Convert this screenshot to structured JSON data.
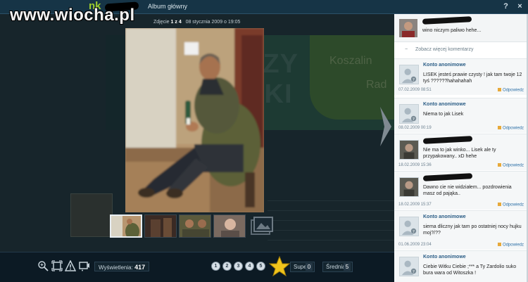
{
  "watermark": "www.wiocha.pl",
  "topbar": {
    "logo_nk": "nk",
    "album_title": "Album główny",
    "help": "?",
    "close": "×"
  },
  "photo": {
    "counter_prefix": "Zdjęcie",
    "counter": "1 z 4",
    "date": "08 stycznia 2009 o 19:05"
  },
  "toolbar": {
    "views_label": "Wyświetlenia:",
    "views_value": "417",
    "rating_buttons": [
      "1",
      "2",
      "3",
      "4",
      "5"
    ],
    "super_label": "Super",
    "super_value": "0",
    "avg_label": "Średnia:",
    "avg_value": "5"
  },
  "comments": {
    "top_text": "wino niczym paliwo hehe...",
    "more_link": "Zobacz więcej komentarzy",
    "items": [
      {
        "author": "Konto anonimowe",
        "text": "LISEK jesteś prawie czysty ! jak tam twoje 12 tyś ??????hahahahah",
        "date": "07.02.2009 08:51",
        "reply": "Odpowiedz"
      },
      {
        "author": "Konto anonimowe",
        "text": "Niema to jak Lisek",
        "date": "08.02.2009 00:19",
        "reply": "Odpowiedz"
      },
      {
        "author": "",
        "text": "Nie ma to jak winko... Lisek ale ty przypakowany.. xD hehe",
        "date": "18.02.2009 15:36",
        "reply": "Odpowiedz"
      },
      {
        "author": "",
        "text": "Dawno cie nie widziałem... pozdrowienia masz od pająka..",
        "date": "18.02.2009 15:37",
        "reply": "Odpowiedz"
      },
      {
        "author": "Konto anonimowe",
        "text": "siema dliczny jak tam po ostatniej nocy hujku moj?/??",
        "date": "01.06.2009 23:04",
        "reply": "Odpowiedz"
      },
      {
        "author": "Konto anonimowe",
        "text": "Ciebie Witku Ciebie ;*** a Ty Zardolio suko bura wara od Witoszka !",
        "date": "",
        "reply": ""
      }
    ]
  }
}
